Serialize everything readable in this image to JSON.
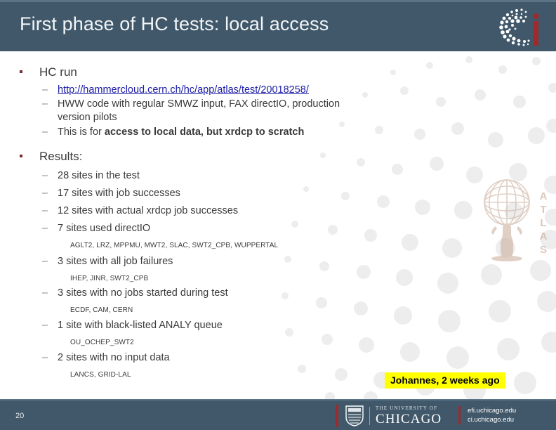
{
  "header": {
    "title": "First phase of HC tests: local access",
    "logo_name": "ci-logo",
    "bg_color": "#40586a"
  },
  "content": {
    "sections": [
      {
        "label": "HC run",
        "items": [
          {
            "type": "link",
            "text": "http://hammercloud.cern.ch/hc/app/atlas/test/20018258/"
          },
          {
            "type": "text",
            "text": "HWW code with regular SMWZ input, FAX directIO, production version pilots"
          },
          {
            "type": "rich",
            "plain": "This is for ",
            "bold": "access to local data, but xrdcp to scratch"
          }
        ]
      },
      {
        "label": "Results:",
        "items": [
          {
            "type": "text",
            "text": "28 sites in the test"
          },
          {
            "type": "text",
            "text": "17 sites with job successes"
          },
          {
            "type": "text",
            "text": "12 sites with actual xrdcp job successes"
          },
          {
            "type": "text",
            "text": "7 sites used directIO"
          },
          {
            "type": "sites",
            "text": "AGLT2, LRZ, MPPMU, MWT2, SLAC, SWT2_CPB, WUPPERTAL"
          },
          {
            "type": "text",
            "text": "3 sites with all job failures"
          },
          {
            "type": "sites",
            "text": "IHEP, JINR, SWT2_CPB"
          },
          {
            "type": "text",
            "text": "3 sites with no jobs started during test"
          },
          {
            "type": "sites",
            "text": "ECDF, CAM, CERN"
          },
          {
            "type": "text",
            "text": "1 site with black-listed ANALY queue"
          },
          {
            "type": "sites",
            "text": "OU_OCHEP_SWT2"
          },
          {
            "type": "text",
            "text": "2 sites with no input data"
          },
          {
            "type": "sites",
            "text": "LANCS, GRID-LAL"
          }
        ]
      }
    ],
    "watermark": "atlas-logo-watermark",
    "annotation": {
      "text": "Johannes, 2 weeks ago",
      "highlight_color": "#ffff00",
      "text_color": "#000000"
    }
  },
  "footer": {
    "page_number": "20",
    "university_small": "THE UNIVERSITY OF",
    "university_big": "CHICAGO",
    "url_line1": "efi.uchicago.edu",
    "url_line2": "ci.uchicago.edu",
    "accent_color": "#9e2a2b"
  }
}
